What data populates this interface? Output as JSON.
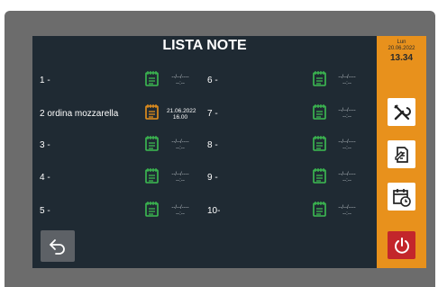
{
  "header": {
    "title": "LISTA NOTE"
  },
  "side_panel": {
    "day": "Lun",
    "date": "20.06.2022",
    "time": "13.34",
    "buttons": [
      {
        "icon": "tools-icon"
      },
      {
        "icon": "document-edit-icon"
      },
      {
        "icon": "calendar-clock-icon"
      },
      {
        "icon": "power-icon"
      }
    ]
  },
  "notes_left": [
    {
      "label": "1 -",
      "date": "--/--/----",
      "time": "--:--",
      "icon_color": "#3dbd52"
    },
    {
      "label": "2 ordina mozzarella",
      "date": "21.06.2022",
      "time": "16.00",
      "icon_color": "#e8911c"
    },
    {
      "label": "3 -",
      "date": "--/--/----",
      "time": "--:--",
      "icon_color": "#3dbd52"
    },
    {
      "label": "4 -",
      "date": "--/--/----",
      "time": "--:--",
      "icon_color": "#3dbd52"
    },
    {
      "label": "5 -",
      "date": "--/--/----",
      "time": "--:--",
      "icon_color": "#3dbd52"
    }
  ],
  "notes_right": [
    {
      "label": "6 -",
      "date": "--/--/----",
      "time": "--:--",
      "icon_color": "#3dbd52"
    },
    {
      "label": "7 -",
      "date": "--/--/----",
      "time": "--:--",
      "icon_color": "#3dbd52"
    },
    {
      "label": "8 -",
      "date": "--/--/----",
      "time": "--:--",
      "icon_color": "#3dbd52"
    },
    {
      "label": "9 -",
      "date": "--/--/----",
      "time": "--:--",
      "icon_color": "#3dbd52"
    },
    {
      "label": "10-",
      "date": "--/--/----",
      "time": "--:--",
      "icon_color": "#3dbd52"
    }
  ],
  "colors": {
    "screen_bg": "#1f2a33",
    "accent_orange": "#e8911c",
    "note_green": "#3dbd52",
    "power_red": "#c3262b"
  },
  "back_button": {
    "icon": "back-arrow-icon"
  }
}
